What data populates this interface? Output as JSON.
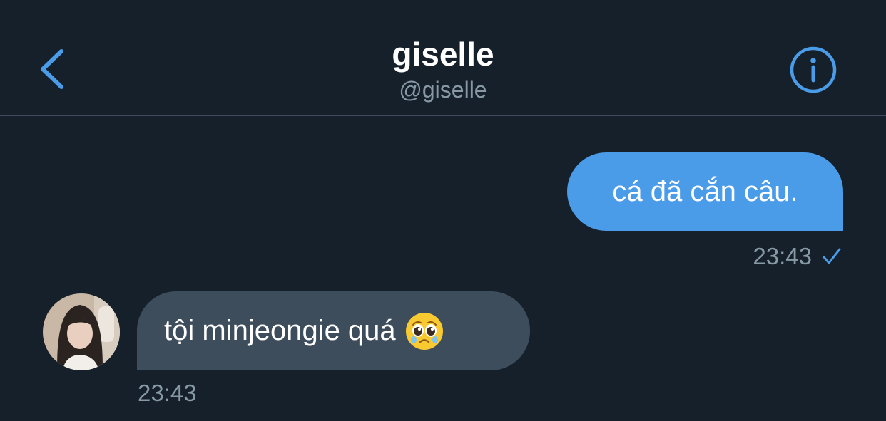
{
  "header": {
    "title": "giselle",
    "handle": "@giselle",
    "back_icon": "chevron-left-icon",
    "info_icon": "info-circle-icon"
  },
  "messages": [
    {
      "direction": "outgoing",
      "text": "cá đã cắn câu.",
      "time": "23:43",
      "status_icon": "checkmark-icon"
    },
    {
      "direction": "incoming",
      "text": "tội minjeongie quá",
      "emoji": "pleading-face-icon",
      "time": "23:43"
    }
  ],
  "colors": {
    "background": "#15202b",
    "accent": "#4a9be8",
    "outgoing_bubble": "#4a9be8",
    "incoming_bubble": "#3e4d5c",
    "secondary_text": "#8899a6",
    "divider": "#3d4b5a"
  }
}
